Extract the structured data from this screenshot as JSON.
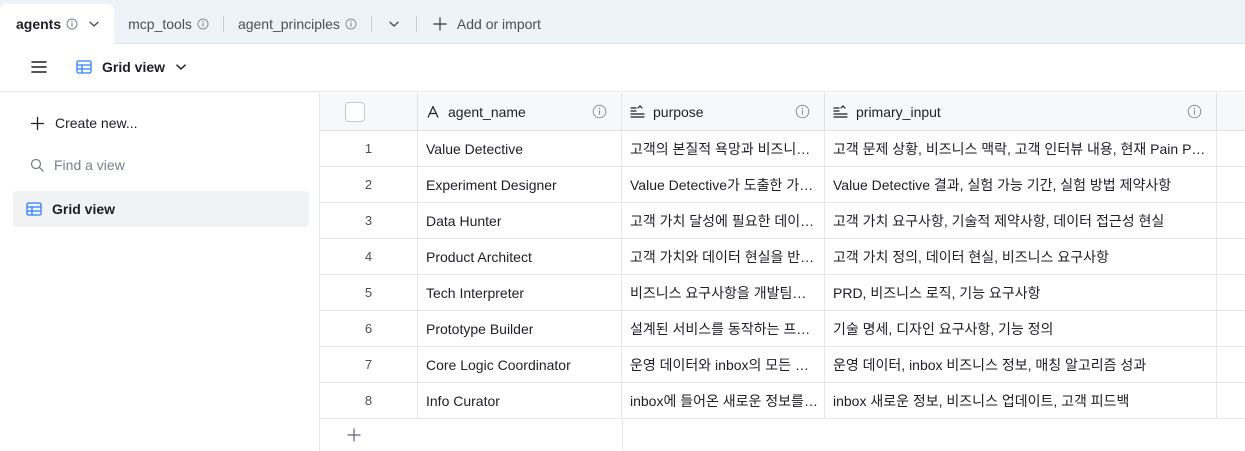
{
  "tabs": [
    {
      "label": "agents",
      "active": true
    },
    {
      "label": "mcp_tools",
      "active": false
    },
    {
      "label": "agent_principles",
      "active": false
    }
  ],
  "add_import_label": "Add or import",
  "view": {
    "name": "Grid view"
  },
  "sidebar": {
    "create_new_label": "Create new...",
    "find_placeholder": "Find a view",
    "views": [
      {
        "label": "Grid view"
      }
    ]
  },
  "grid": {
    "columns": [
      {
        "label": "agent_name",
        "type_icon": "text-a-icon"
      },
      {
        "label": "purpose",
        "type_icon": "long-text-icon"
      },
      {
        "label": "primary_input",
        "type_icon": "long-text-icon"
      }
    ],
    "rows": [
      {
        "num": "1",
        "agent_name": "Value Detective",
        "purpose": "고객의 본질적 욕망과 비즈니스 맥락을",
        "primary_input": "고객 문제 상황, 비즈니스 맥락, 고객 인터뷰 내용, 현재 Pain Point"
      },
      {
        "num": "2",
        "agent_name": "Experiment Designer",
        "purpose": "Value Detective가 도출한 가설을",
        "primary_input": "Value Detective 결과, 실험 가능 기간, 실험 방법 제약사항"
      },
      {
        "num": "3",
        "agent_name": "Data Hunter",
        "purpose": "고객 가치 달성에 필요한 데이터를",
        "primary_input": "고객 가치 요구사항, 기술적 제약사항, 데이터 접근성 현실"
      },
      {
        "num": "4",
        "agent_name": "Product Architect",
        "purpose": "고객 가치와 데이터 현실을 반영한",
        "primary_input": "고객 가치 정의, 데이터 현실, 비즈니스 요구사항"
      },
      {
        "num": "5",
        "agent_name": "Tech Interpreter",
        "purpose": "비즈니스 요구사항을 개발팀이 이해할",
        "primary_input": "PRD, 비즈니스 로직, 기능 요구사항"
      },
      {
        "num": "6",
        "agent_name": "Prototype Builder",
        "purpose": "설계된 서비스를 동작하는 프로토타입으로",
        "primary_input": "기술 명세, 디자인 요구사항, 기능 정의"
      },
      {
        "num": "7",
        "agent_name": "Core Logic Coordinator",
        "purpose": "운영 데이터와 inbox의 모든 정보를",
        "primary_input": "운영 데이터, inbox 비즈니스 정보, 매칭 알고리즘 성과"
      },
      {
        "num": "8",
        "agent_name": "Info Curator",
        "purpose": "inbox에 들어온 새로운 정보를 분류하고",
        "primary_input": "inbox 새로운 정보, 비즈니스 업데이트, 고객 피드백"
      }
    ]
  },
  "colors": {
    "accent": "#2d7ff9",
    "tabbar_bg": "#eef2f9",
    "header_bg": "#f7f8fa",
    "selected_view_bg": "#f1f2f4"
  }
}
